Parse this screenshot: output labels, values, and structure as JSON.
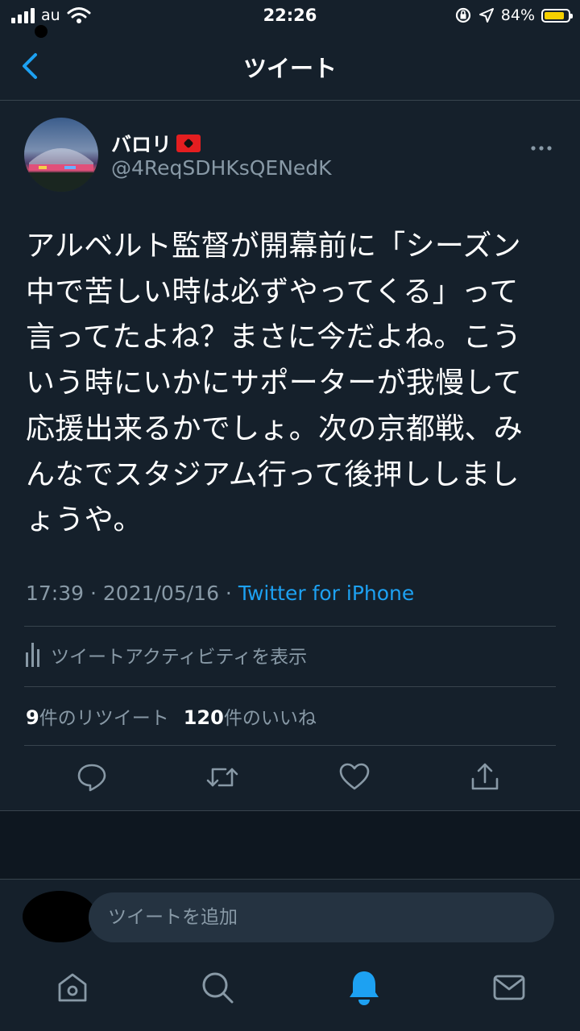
{
  "status_bar": {
    "carrier": "au",
    "time": "22:26",
    "battery_percent": "84%",
    "battery_level": 0.84
  },
  "header": {
    "title": "ツイート",
    "back_icon": "chevron-left-icon"
  },
  "tweet": {
    "display_name": "バロリ",
    "handle": "@4ReqSDHKsQENedK",
    "text_lines": [
      "アルベルト監督が開幕前に「シーズン",
      "中で苦しい時は必ずやってくる」って",
      "言ってたよね？まさに今だよね。こう",
      "いう時にいかにサポーターが我慢して",
      "応援出来るかでしょ。次の京都戦、み",
      "んなでスタジアム行って後押ししまし",
      "ょうや。"
    ],
    "time": "17:39",
    "date": "2021/05/16",
    "separator": " · ",
    "source": "Twitter for iPhone",
    "activity_label": "ツイートアクティビティを表示",
    "retweet_count": "9",
    "retweet_label": "件のリツイート",
    "like_count": "120",
    "like_label": "件のいいね"
  },
  "reply": {
    "placeholder": "ツイートを追加"
  },
  "tab_bar": {
    "items": [
      "home-icon",
      "search-icon",
      "notifications-icon",
      "messages-icon"
    ],
    "active": "notifications-icon"
  },
  "colors": {
    "background": "#15202b",
    "accent": "#1da1f2",
    "secondary_text": "#8899a6",
    "divider": "#38444d",
    "battery": "#f5d000"
  }
}
